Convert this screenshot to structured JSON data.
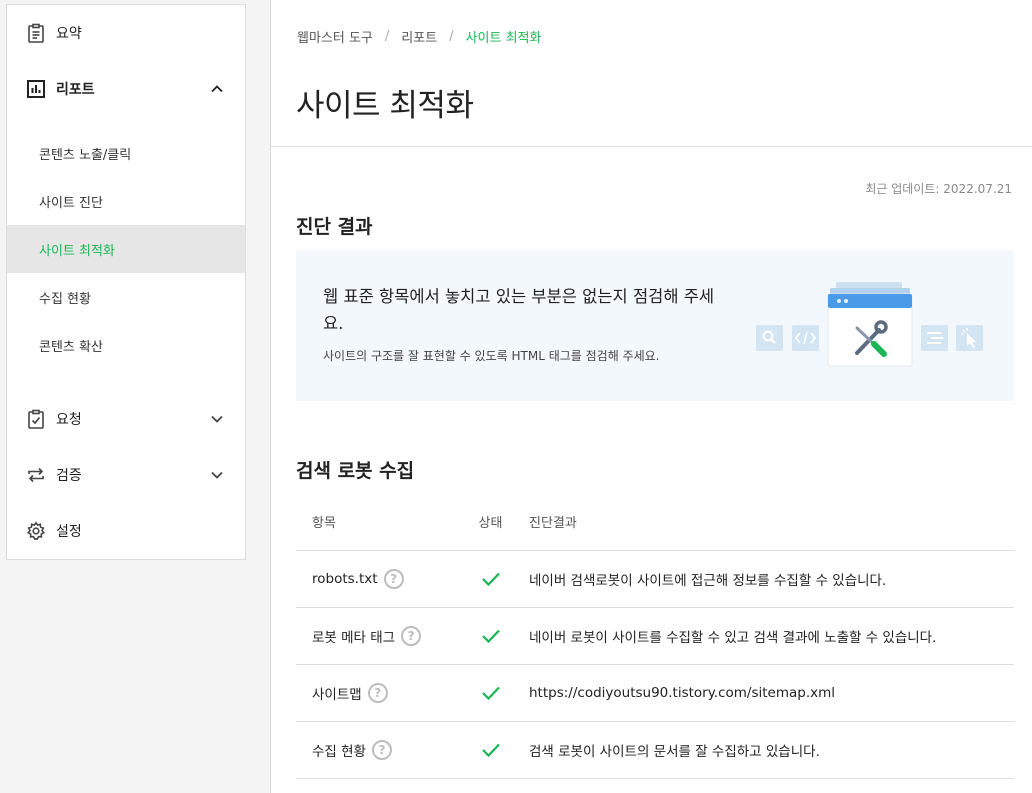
{
  "sidebar": {
    "summary": "요약",
    "report": "리포트",
    "report_items": [
      "콘텐츠 노출/클릭",
      "사이트 진단",
      "사이트 최적화",
      "수집 현황",
      "콘텐츠 확산"
    ],
    "request": "요청",
    "verify": "검증",
    "settings": "설정"
  },
  "breadcrumb": [
    "웹마스터 도구",
    "리포트",
    "사이트 최적화"
  ],
  "page_title": "사이트 최적화",
  "updated": "최근 업데이트: 2022.07.21",
  "diagnosis": {
    "title": "진단 결과",
    "main_text": "웹 표준 항목에서 놓치고 있는 부분은 없는지 점검해 주세요.",
    "sub_text": "사이트의 구조를 잘 표현할 수 있도록 HTML 태그를 점검해 주세요."
  },
  "robot": {
    "title": "검색 로봇 수집",
    "headers": [
      "항목",
      "상태",
      "진단결과"
    ],
    "help_glyph": "?",
    "rows": [
      {
        "item": "robots.txt",
        "result": "네이버 검색로봇이 사이트에 접근해 정보를 수집할 수 있습니다."
      },
      {
        "item": "로봇 메타 태그",
        "result": "네이버 로봇이 사이트를 수집할 수 있고 검색 결과에 노출할 수 있습니다."
      },
      {
        "item": "사이트맵",
        "result": "https://codiyoutsu90.tistory.com/sitemap.xml"
      },
      {
        "item": "수집 현황",
        "result": "검색 로봇이 사이트의 문서를 잘 수집하고 있습니다."
      }
    ]
  },
  "colors": {
    "accent": "#1bb554",
    "status_ok": "#1bb554",
    "illus_blue": "#4a9ae8"
  },
  "icons": {
    "summary": "clipboard-icon",
    "report": "bar-chart-icon",
    "request": "clipboard-check-icon",
    "verify": "repeat-icon",
    "settings": "gear-icon",
    "status": "check-icon"
  }
}
